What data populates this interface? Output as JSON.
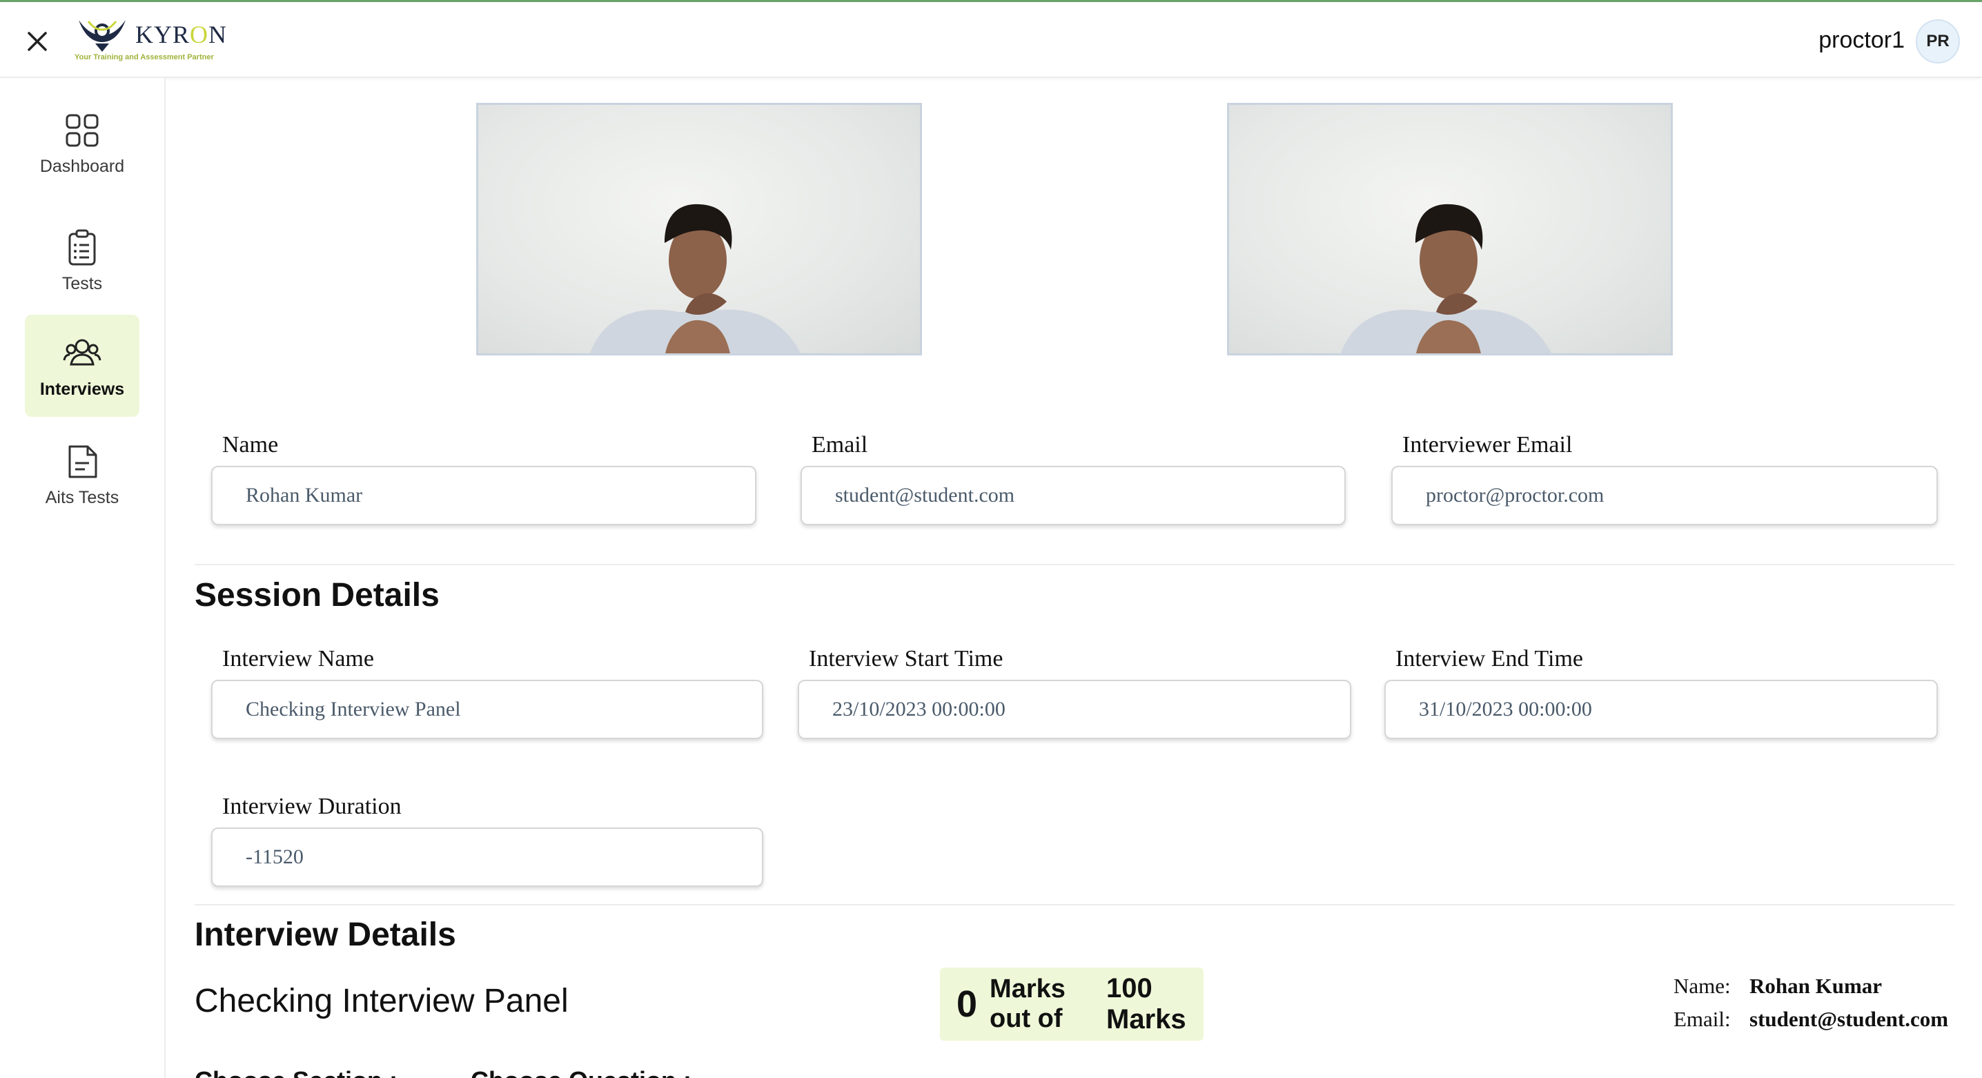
{
  "header": {
    "logo_text": "KYRON",
    "logo_tagline": "Your Training and Assessment Partner",
    "user_name": "proctor1",
    "avatar_initials": "PR"
  },
  "sidebar": {
    "items": [
      {
        "label": "Dashboard",
        "icon": "grid-icon",
        "active": false
      },
      {
        "label": "Tests",
        "icon": "clipboard-icon",
        "active": false
      },
      {
        "label": "Interviews",
        "icon": "users-icon",
        "active": true
      },
      {
        "label": "Aits Tests",
        "icon": "document-icon",
        "active": false
      }
    ]
  },
  "candidate": {
    "name_label": "Name",
    "name_value": "Rohan Kumar",
    "email_label": "Email",
    "email_value": "student@student.com",
    "interviewer_email_label": "Interviewer Email",
    "interviewer_email_value": "proctor@proctor.com"
  },
  "session": {
    "title": "Session Details",
    "interview_name_label": "Interview Name",
    "interview_name_value": "Checking Interview Panel",
    "start_label": "Interview Start Time",
    "start_value": "23/10/2023 00:00:00",
    "end_label": "Interview End Time",
    "end_value": "31/10/2023 00:00:00",
    "duration_label": "Interview Duration",
    "duration_value": "-11520"
  },
  "interview_details": {
    "title": "Interview Details",
    "panel_name": "Checking Interview Panel",
    "marks_obtained": "0",
    "marks_text": "Marks out of",
    "marks_total": "100 Marks",
    "info_name_label": "Name:",
    "info_name_value": "Rohan Kumar",
    "info_email_label": "Email:",
    "info_email_value": "student@student.com",
    "choose_section_label": "Choose Section :",
    "choose_question_label": "Choose Question :"
  },
  "colors": {
    "accent_bg": "#eef8d8",
    "top_border": "#6aa36a"
  }
}
